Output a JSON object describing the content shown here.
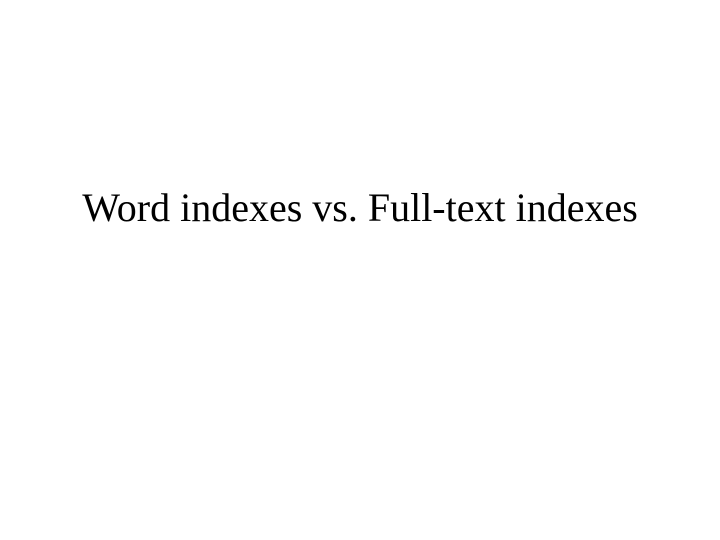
{
  "slide": {
    "title": "Word indexes vs. Full-text indexes"
  }
}
